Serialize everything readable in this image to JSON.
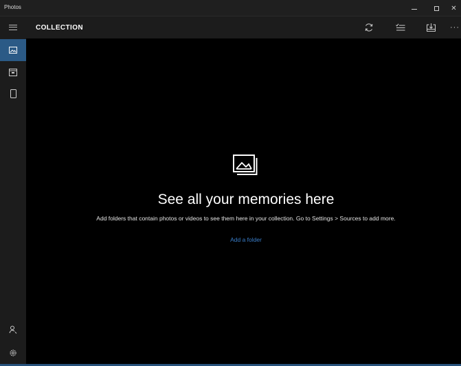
{
  "window": {
    "title": "Photos",
    "controls": {
      "minimize": "–",
      "maximize": "□",
      "close": "✕"
    }
  },
  "sidebar": {
    "items": [
      {
        "name": "menu",
        "icon": "hamburger-icon"
      },
      {
        "name": "collection",
        "icon": "photo-icon",
        "active": true
      },
      {
        "name": "albums",
        "icon": "album-icon"
      },
      {
        "name": "folders",
        "icon": "device-icon"
      },
      {
        "name": "account",
        "icon": "person-icon"
      },
      {
        "name": "settings",
        "icon": "gear-icon"
      }
    ]
  },
  "header": {
    "title": "COLLECTION",
    "tools": [
      {
        "name": "refresh",
        "icon": "refresh-icon"
      },
      {
        "name": "select",
        "icon": "select-list-icon"
      },
      {
        "name": "import",
        "icon": "import-icon"
      },
      {
        "name": "more",
        "label": "···"
      }
    ]
  },
  "empty_state": {
    "icon": "photos-stack-icon",
    "headline": "See all your memories here",
    "description": "Add folders that contain photos or videos to see them here in your collection. Go to Settings > Sources to add more.",
    "link_label": "Add a folder"
  },
  "colors": {
    "background": "#000000",
    "chrome": "#1c1c1c",
    "accent": "#2b5a86",
    "link": "#3a7ec9"
  }
}
